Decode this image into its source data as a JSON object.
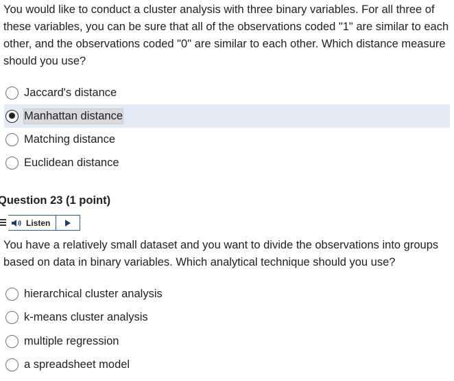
{
  "q1": {
    "text": "You would like to conduct a cluster analysis with three binary variables. For all three of these variables, you can be sure that all of the observations coded \"1\" are similar to each other, and the observations coded \"0\" are similar to each other. Which distance measure should you use?",
    "options": [
      {
        "label": "Jaccard's distance",
        "selected": false
      },
      {
        "label": "Manhattan distance",
        "selected": true
      },
      {
        "label": "Matching distance",
        "selected": false
      },
      {
        "label": "Euclidean distance",
        "selected": false
      }
    ]
  },
  "q2": {
    "heading_number": "Question 23",
    "heading_points": "(1 point)",
    "listen_label": "Listen",
    "text": "You have a relatively small dataset and you want to divide the observations into groups based on data in binary variables. Which analytical technique should you use?",
    "options": [
      {
        "label": "hierarchical cluster analysis",
        "selected": false
      },
      {
        "label": "k-means cluster analysis",
        "selected": false
      },
      {
        "label": "multiple regression",
        "selected": false
      },
      {
        "label": "a spreadsheet model",
        "selected": false
      }
    ]
  }
}
